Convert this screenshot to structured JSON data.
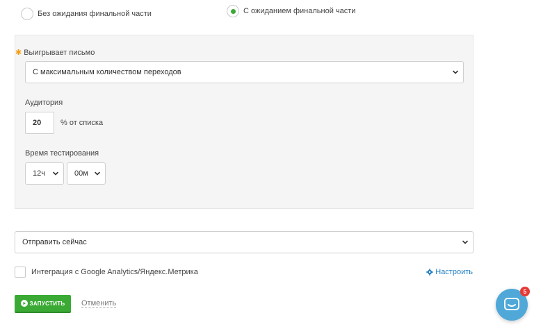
{
  "test_mode": {
    "option_no_wait": "Без ожидания финальной части",
    "option_wait": "С ожиданием финальной части",
    "selected": "option_wait"
  },
  "winner": {
    "label": "Выигрывает письмо",
    "required_mark": "✱",
    "selected_value": "С максимальным количеством переходов"
  },
  "audience": {
    "label": "Аудитория",
    "value": "20",
    "suffix": "% от списка"
  },
  "test_time": {
    "label": "Время тестирования",
    "hours": "12ч",
    "minutes": "00м"
  },
  "send": {
    "selected_value": "Отправить сейчас"
  },
  "analytics": {
    "label": "Интеграция с Google Analytics/Яндекс.Метрика",
    "checked": false,
    "configure_label": "Настроить"
  },
  "actions": {
    "start_label": "ЗАПУСТИТЬ",
    "cancel_label": "Отменить"
  },
  "chat": {
    "badge_count": "5"
  },
  "colors": {
    "accent_green": "#3aaa35",
    "link_blue": "#1f7dc1",
    "chat_blue": "#4fa8d8",
    "badge_red": "#e53935",
    "required_orange": "#f39c12"
  }
}
